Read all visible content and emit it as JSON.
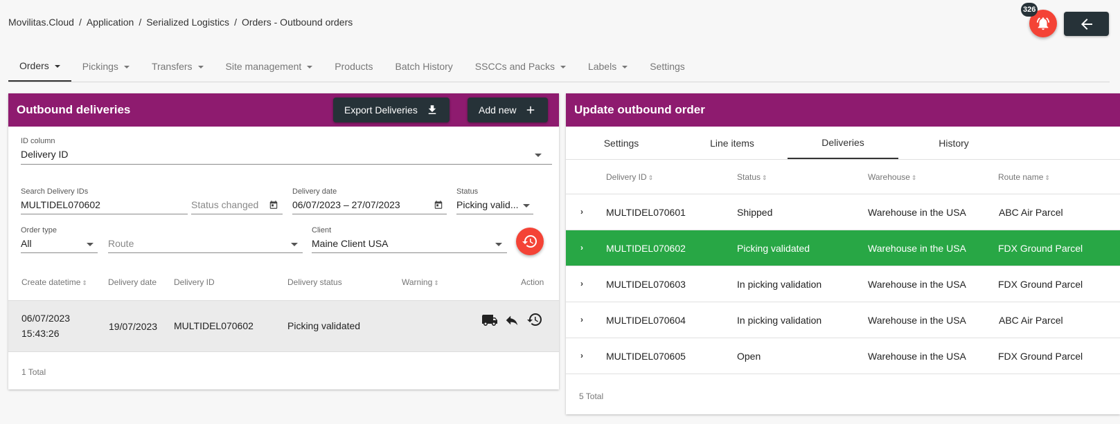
{
  "breadcrumb": [
    "Movilitas.Cloud",
    "Application",
    "Serialized Logistics",
    "Orders - Outbound orders"
  ],
  "notifications": {
    "count": "326"
  },
  "nav": {
    "tabs": [
      {
        "label": "Orders",
        "dropdown": true,
        "active": true
      },
      {
        "label": "Pickings",
        "dropdown": true
      },
      {
        "label": "Transfers",
        "dropdown": true
      },
      {
        "label": "Site management",
        "dropdown": true
      },
      {
        "label": "Products",
        "dropdown": false
      },
      {
        "label": "Batch History",
        "dropdown": false
      },
      {
        "label": "SSCCs and Packs",
        "dropdown": true
      },
      {
        "label": "Labels",
        "dropdown": true
      },
      {
        "label": "Settings",
        "dropdown": false
      }
    ]
  },
  "left": {
    "title": "Outbound deliveries",
    "export_label": "Export Deliveries",
    "add_label": "Add new",
    "id_column": {
      "label": "ID column",
      "value": "Delivery ID"
    },
    "search": {
      "label": "Search Delivery IDs",
      "value": "MULTIDEL070602"
    },
    "status_changed": {
      "placeholder": "Status changed"
    },
    "delivery_date": {
      "label": "Delivery date",
      "value": "06/07/2023 – 27/07/2023"
    },
    "status": {
      "label": "Status",
      "value": "Picking valid..."
    },
    "order_type": {
      "label": "Order type",
      "value": "All"
    },
    "route": {
      "placeholder": "Route"
    },
    "client": {
      "label": "Client",
      "value": "Maine Client USA"
    },
    "columns": [
      "Create datetime",
      "Delivery date",
      "Delivery ID",
      "Delivery status",
      "Warning",
      "Action"
    ],
    "rows": [
      {
        "create_date": "06/07/2023",
        "create_time": "15:43:26",
        "delivery_date": "19/07/2023",
        "delivery_id": "MULTIDEL070602",
        "status": "Picking validated"
      }
    ],
    "total": "1 Total"
  },
  "right": {
    "title": "Update outbound order",
    "tabs": [
      "Settings",
      "Line items",
      "Deliveries",
      "History"
    ],
    "active_tab": "Deliveries",
    "columns": [
      "Delivery ID",
      "Status",
      "Warehouse",
      "Route name"
    ],
    "rows": [
      {
        "id": "MULTIDEL070601",
        "status": "Shipped",
        "warehouse": "Warehouse in the USA",
        "route": "ABC Air Parcel"
      },
      {
        "id": "MULTIDEL070602",
        "status": "Picking validated",
        "warehouse": "Warehouse in the USA",
        "route": "FDX Ground Parcel"
      },
      {
        "id": "MULTIDEL070603",
        "status": "In picking validation",
        "warehouse": "Warehouse in the USA",
        "route": "FDX Ground Parcel"
      },
      {
        "id": "MULTIDEL070604",
        "status": "In picking validation",
        "warehouse": "Warehouse in the USA",
        "route": "ABC Air Parcel"
      },
      {
        "id": "MULTIDEL070605",
        "status": "Open",
        "warehouse": "Warehouse in the USA",
        "route": "FDX Ground Parcel"
      }
    ],
    "selected_row": 1,
    "total": "5 Total"
  },
  "colors": {
    "header": "#8e1b6f",
    "dark": "#263238",
    "danger": "#f44336",
    "selected": "#28a745"
  }
}
